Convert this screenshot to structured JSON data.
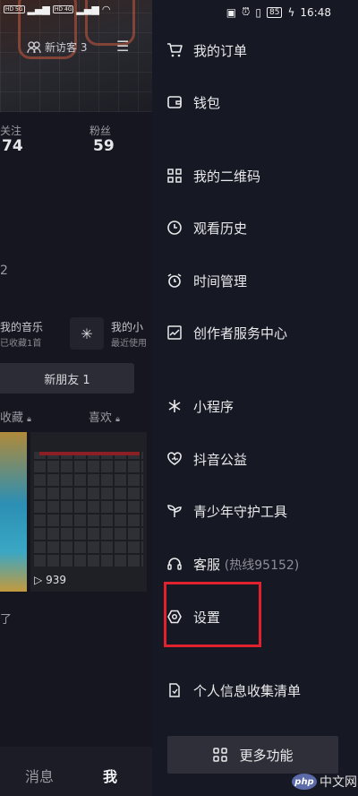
{
  "status_bar": {
    "sim1": "HD 5G",
    "sim2": "HD 4G",
    "battery": "85",
    "time": "16:48"
  },
  "profile_bg": {
    "visitor_label": "新访客 3",
    "following_label": "关注",
    "following_count": "74",
    "followers_label": "粉丝",
    "followers_count": "59",
    "partial_count": "2",
    "music_title": "我的音乐",
    "music_sub": "已收藏1首",
    "mini_title": "我的小",
    "mini_sub": "最近使用",
    "new_friends": "新朋友 1",
    "tab_collect": "收藏",
    "tab_likes": "喜欢",
    "play_count": "939",
    "trailing_text": "了",
    "nav_messages": "消息",
    "nav_me": "我"
  },
  "drawer": {
    "items": [
      {
        "label": "我的订单",
        "icon": "cart-icon"
      },
      {
        "label": "钱包",
        "icon": "wallet-icon"
      },
      {
        "label": "我的二维码",
        "icon": "qrcode-icon"
      },
      {
        "label": "观看历史",
        "icon": "clock-icon"
      },
      {
        "label": "时间管理",
        "icon": "alarm-icon"
      },
      {
        "label": "创作者服务中心",
        "icon": "chart-icon"
      },
      {
        "label": "小程序",
        "icon": "asterisk-icon"
      },
      {
        "label": "抖音公益",
        "icon": "heart-icon"
      },
      {
        "label": "青少年守护工具",
        "icon": "sprout-icon"
      },
      {
        "label": "客服",
        "hint": "(热线95152)",
        "icon": "headset-icon"
      },
      {
        "label": "设置",
        "icon": "settings-icon"
      },
      {
        "label": "个人信息收集清单",
        "icon": "doc-icon"
      }
    ],
    "more_button": "更多功能"
  },
  "watermark": {
    "logo": "php",
    "text": "中文网"
  },
  "accent_colors": {
    "highlight_box": "#e0222e",
    "background": "#161823"
  }
}
